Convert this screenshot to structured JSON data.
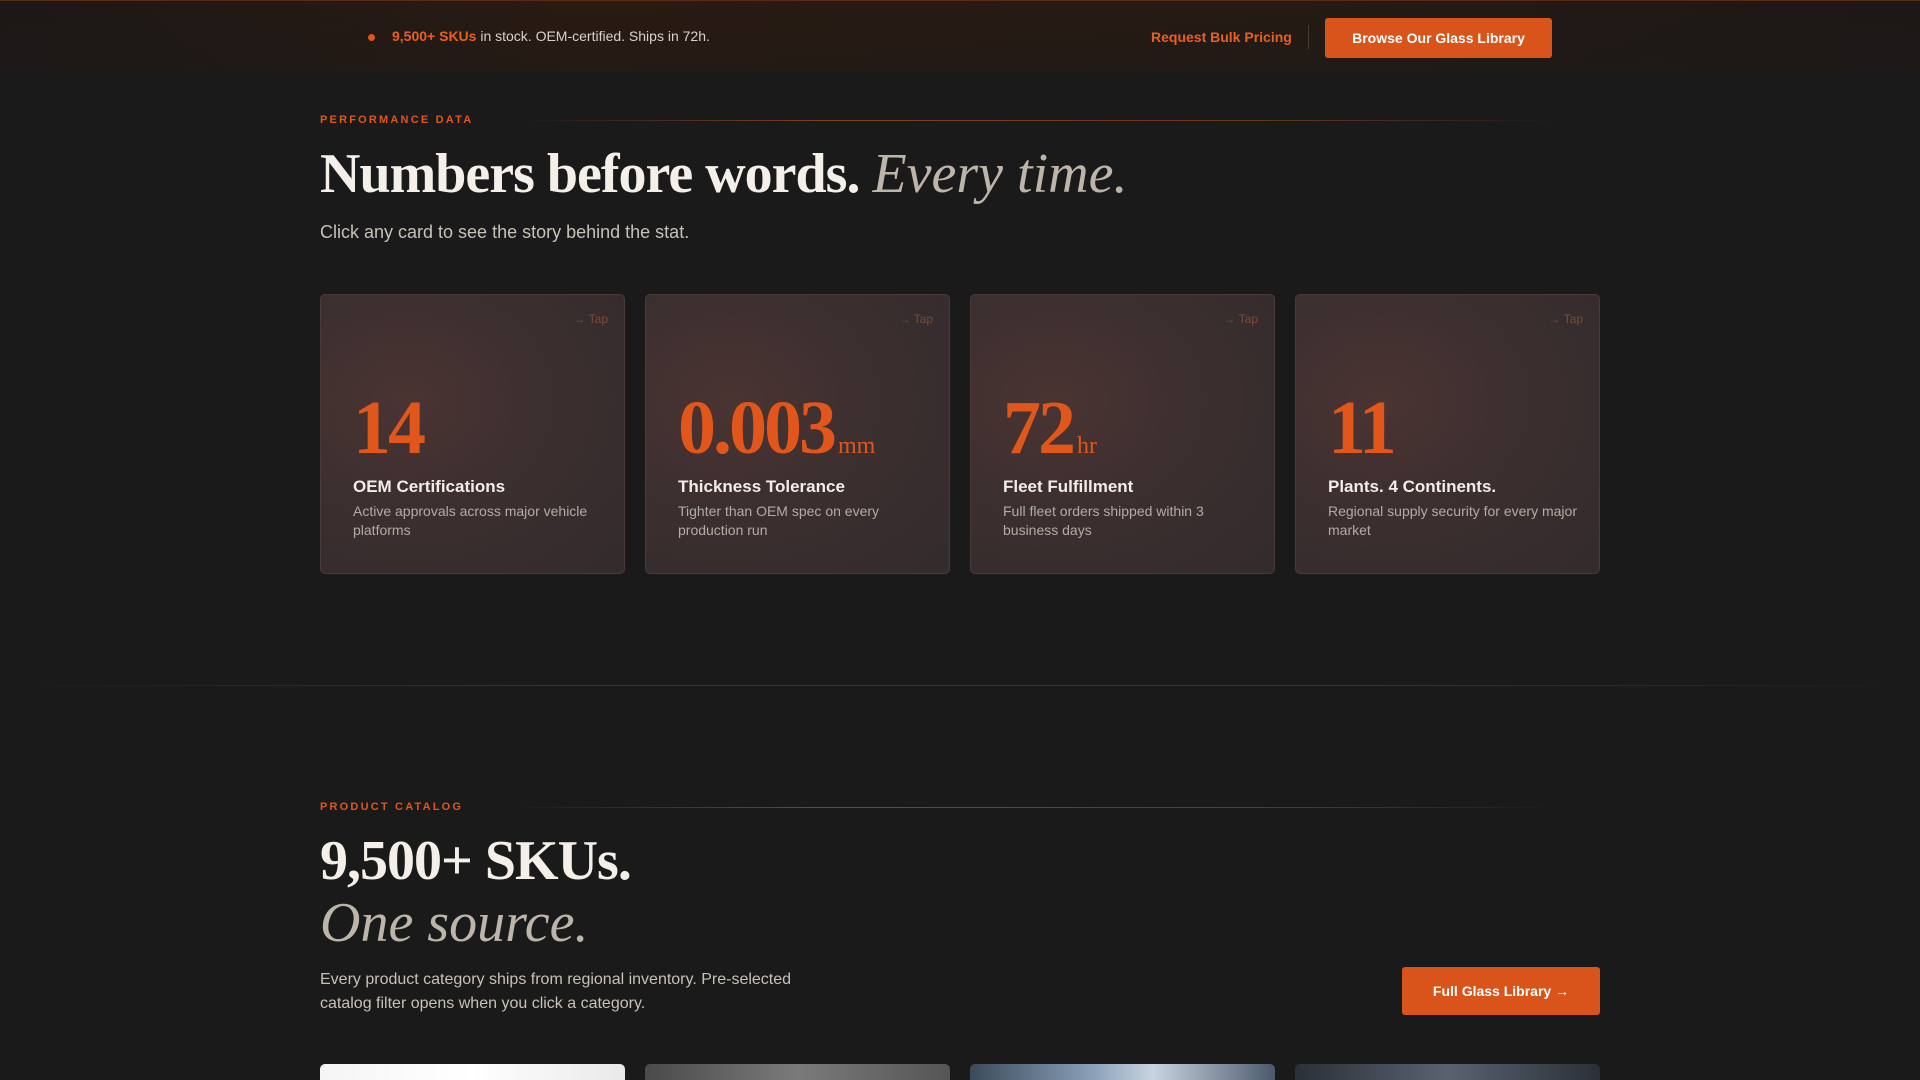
{
  "topbar": {
    "stock_highlight": "9,500+ SKUs",
    "stock_rest": " in stock. OEM-certified. Ships in 72h.",
    "bulk_link": "Request Bulk Pricing",
    "browse_button": "Browse Our Glass Library"
  },
  "performance": {
    "label": "PERFORMANCE DATA",
    "headline_main": "Numbers before words.",
    "headline_italic": "Every time.",
    "subtext": "Click any card to see the story behind the stat.",
    "cards": [
      {
        "tap": "→ Tap",
        "value": "14",
        "unit": "",
        "title": "OEM Certifications",
        "desc": "Active approvals across major vehicle platforms"
      },
      {
        "tap": "→ Tap",
        "value": "0.003",
        "unit": "mm",
        "title": "Thickness Tolerance",
        "desc": "Tighter than OEM spec on every production run"
      },
      {
        "tap": "→ Tap",
        "value": "72",
        "unit": "hr",
        "title": "Fleet Fulfillment",
        "desc": "Full fleet orders shipped within 3 business days"
      },
      {
        "tap": "→ Tap",
        "value": "11",
        "unit": "",
        "title": "Plants. 4 Continents.",
        "desc": "Regional supply security for every major market"
      }
    ]
  },
  "catalog": {
    "label": "PRODUCT CATALOG",
    "headline_main": "9,500+ SKUs.",
    "headline_italic": "One source.",
    "desc": "Every product category ships from regional inventory. Pre-selected catalog filter opens when you click a category.",
    "button": "Full Glass Library →"
  },
  "colors": {
    "accent": "#e0561b",
    "background": "#1a1a1a",
    "card": "#3a2e2e"
  }
}
